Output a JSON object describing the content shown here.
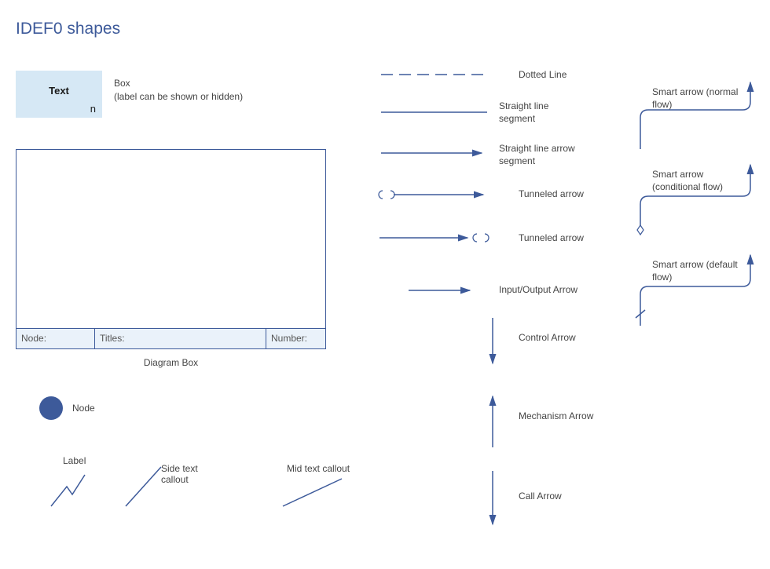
{
  "title": "IDEF0 shapes",
  "box": {
    "text": "Text",
    "n": "n",
    "label_line1": "Box",
    "label_line2": "(label can be shown or hidden)"
  },
  "diagram_box": {
    "node": "Node:",
    "titles": "Titles:",
    "number": "Number:",
    "caption": "Diagram Box"
  },
  "node": {
    "label": "Node"
  },
  "callouts": {
    "label": "Label",
    "side": "Side text callout",
    "mid": "Mid text callout"
  },
  "lines": {
    "dotted": "Dotted Line",
    "straight_seg": "Straight line segment",
    "straight_arrow_seg": "Straight line arrow segment",
    "tunneled1": "Tunneled arrow",
    "tunneled2": "Tunneled arrow",
    "io_arrow": "Input/Output Arrow",
    "control": "Control Arrow",
    "mechanism": "Mechanism Arrow",
    "call": "Call Arrow"
  },
  "smart": {
    "normal": "Smart arrow (normal flow)",
    "conditional": "Smart arrow (conditional flow)",
    "default": "Smart arrow (default flow)"
  },
  "colors": {
    "accent": "#3d5a9a"
  }
}
